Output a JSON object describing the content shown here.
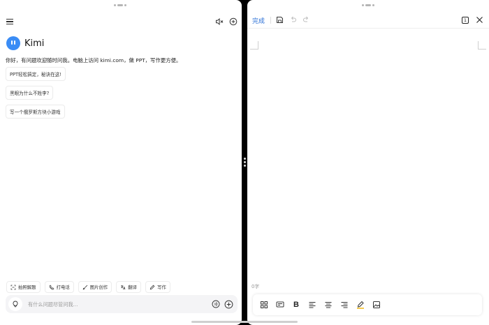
{
  "left_pane": {
    "brand": {
      "name": "Kimi",
      "accent": "#3A8CF5"
    },
    "welcome": "你好，有问题欢迎随时问我。电脑上访问 kimi.com，做 PPT，写作更方便。",
    "suggested_prompts": [
      "PPT轻松搞定，秘诀在这!",
      "黑眼为什么不姓李?",
      "写一个俄罗斯方块小游戏"
    ],
    "quick_actions": [
      {
        "label": "拍照解题",
        "icon": "scan-icon"
      },
      {
        "label": "打电话",
        "icon": "phone-icon"
      },
      {
        "label": "图片创作",
        "icon": "paint-brush-icon"
      },
      {
        "label": "翻译",
        "icon": "translate-icon"
      },
      {
        "label": "写作",
        "icon": "pen-icon"
      }
    ],
    "composer": {
      "placeholder": "有什么问题尽管问我..."
    }
  },
  "right_pane": {
    "done_label": "完成",
    "page_count": "1",
    "word_count": "0字",
    "link_color": "#2A6FD6"
  }
}
